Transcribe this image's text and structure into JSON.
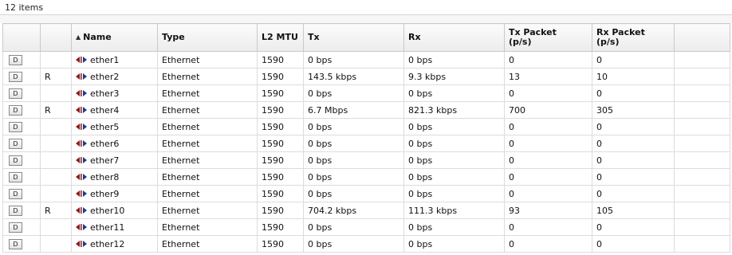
{
  "status": {
    "item_count": "12 items"
  },
  "columns": {
    "d": "",
    "r": "",
    "name": "Name",
    "name_sort": "▲",
    "type": "Type",
    "mtu": "L2 MTU",
    "tx": "Tx",
    "rx": "Rx",
    "tx_packet_1": "Tx Packet",
    "tx_packet_2": "(p/s)",
    "rx_packet_1": "Rx Packet",
    "rx_packet_2": "(p/s)"
  },
  "button_label": "D",
  "icon": "ethernet-port-icon",
  "colors": {
    "icon_left": "#8b1a1a",
    "icon_right": "#1e3a8a"
  },
  "rows": [
    {
      "flag": "",
      "name": "ether1",
      "type": "Ethernet",
      "mtu": "1590",
      "tx": "0 bps",
      "rx": "0 bps",
      "txp": "0",
      "rxp": "0"
    },
    {
      "flag": "R",
      "name": "ether2",
      "type": "Ethernet",
      "mtu": "1590",
      "tx": "143.5 kbps",
      "rx": "9.3 kbps",
      "txp": "13",
      "rxp": "10"
    },
    {
      "flag": "",
      "name": "ether3",
      "type": "Ethernet",
      "mtu": "1590",
      "tx": "0 bps",
      "rx": "0 bps",
      "txp": "0",
      "rxp": "0"
    },
    {
      "flag": "R",
      "name": "ether4",
      "type": "Ethernet",
      "mtu": "1590",
      "tx": "6.7 Mbps",
      "rx": "821.3 kbps",
      "txp": "700",
      "rxp": "305"
    },
    {
      "flag": "",
      "name": "ether5",
      "type": "Ethernet",
      "mtu": "1590",
      "tx": "0 bps",
      "rx": "0 bps",
      "txp": "0",
      "rxp": "0"
    },
    {
      "flag": "",
      "name": "ether6",
      "type": "Ethernet",
      "mtu": "1590",
      "tx": "0 bps",
      "rx": "0 bps",
      "txp": "0",
      "rxp": "0"
    },
    {
      "flag": "",
      "name": "ether7",
      "type": "Ethernet",
      "mtu": "1590",
      "tx": "0 bps",
      "rx": "0 bps",
      "txp": "0",
      "rxp": "0"
    },
    {
      "flag": "",
      "name": "ether8",
      "type": "Ethernet",
      "mtu": "1590",
      "tx": "0 bps",
      "rx": "0 bps",
      "txp": "0",
      "rxp": "0"
    },
    {
      "flag": "",
      "name": "ether9",
      "type": "Ethernet",
      "mtu": "1590",
      "tx": "0 bps",
      "rx": "0 bps",
      "txp": "0",
      "rxp": "0"
    },
    {
      "flag": "R",
      "name": "ether10",
      "type": "Ethernet",
      "mtu": "1590",
      "tx": "704.2 kbps",
      "rx": "111.3 kbps",
      "txp": "93",
      "rxp": "105"
    },
    {
      "flag": "",
      "name": "ether11",
      "type": "Ethernet",
      "mtu": "1590",
      "tx": "0 bps",
      "rx": "0 bps",
      "txp": "0",
      "rxp": "0"
    },
    {
      "flag": "",
      "name": "ether12",
      "type": "Ethernet",
      "mtu": "1590",
      "tx": "0 bps",
      "rx": "0 bps",
      "txp": "0",
      "rxp": "0"
    }
  ]
}
